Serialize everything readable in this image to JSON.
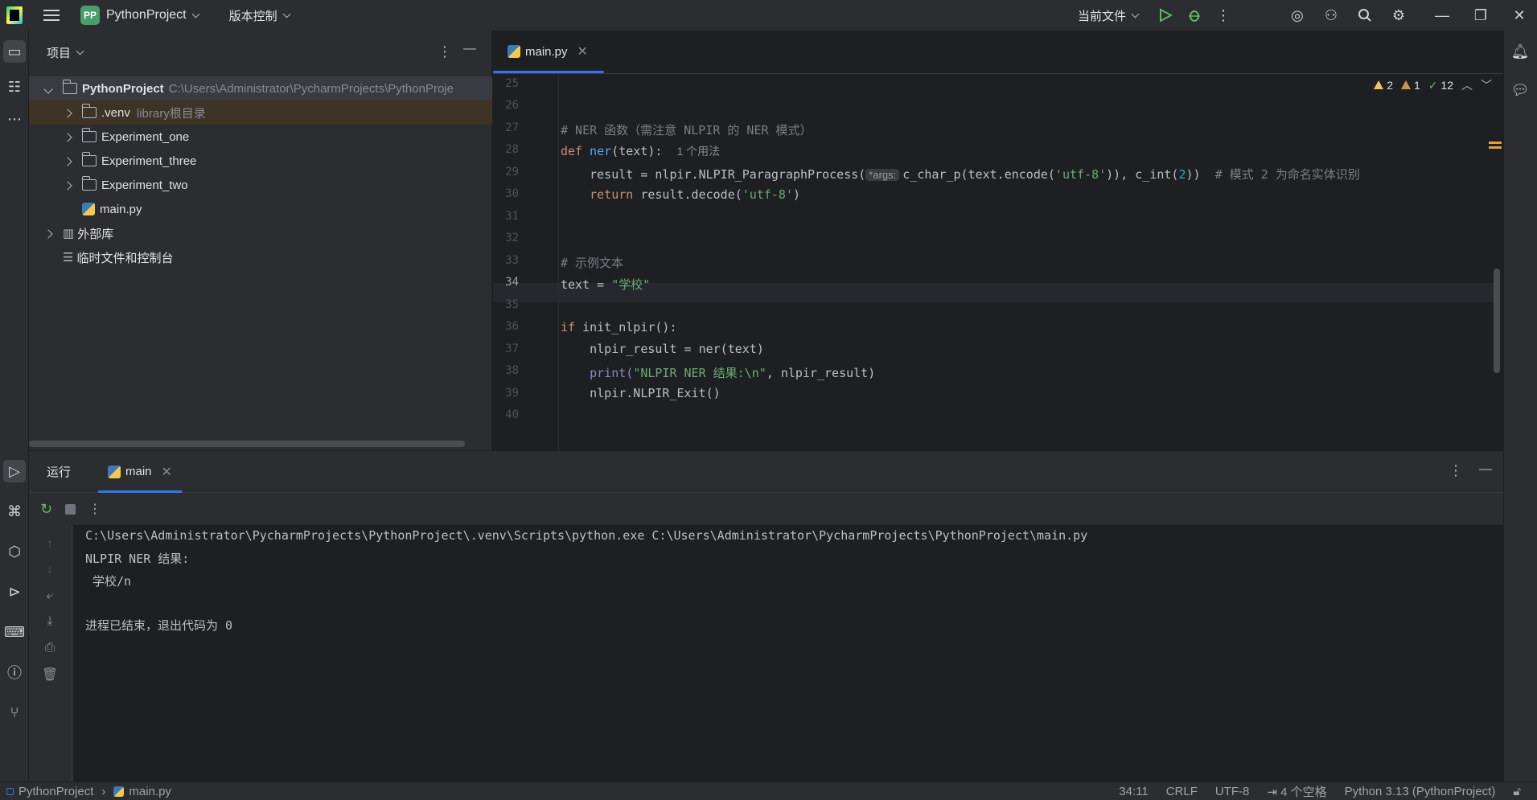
{
  "titlebar": {
    "project_badge": "PP",
    "project_name": "PythonProject",
    "vcs_menu": "版本控制",
    "run_config": "当前文件"
  },
  "project_panel": {
    "title": "项目",
    "tree": [
      {
        "label": "PythonProject",
        "extra": "C:\\Users\\Administrator\\PycharmProjects\\PythonProje"
      },
      {
        "label": ".venv",
        "extra": "library根目录"
      },
      {
        "label": "Experiment_one",
        "extra": ""
      },
      {
        "label": "Experiment_three",
        "extra": ""
      },
      {
        "label": "Experiment_two",
        "extra": ""
      },
      {
        "label": "main.py",
        "extra": ""
      },
      {
        "label": "外部库",
        "extra": ""
      },
      {
        "label": "临时文件和控制台",
        "extra": ""
      }
    ]
  },
  "editor": {
    "tab": "main.py",
    "inspections": {
      "warnings": "2",
      "weak_warnings": "1",
      "ok": "12"
    },
    "line_numbers": [
      "25",
      "26",
      "27",
      "28",
      "29",
      "30",
      "31",
      "32",
      "33",
      "34",
      "35",
      "36",
      "37",
      "38",
      "39",
      "40"
    ],
    "current_line": "34",
    "usage_hint": "1 个用法",
    "param_hint": "*args:",
    "lines": {
      "l27": "# NER 函数（需注意 NLPIR 的 NER 模式）",
      "l28_kw": "def ",
      "l28_fn": "ner",
      "l28_rest": "(text):",
      "l29_a": "    result = nlpir.NLPIR_ParagraphProcess(",
      "l29_b": "c_char_p(text.encode(",
      "l29_str": "'utf-8'",
      "l29_c": ")), c_int(",
      "l29_num": "2",
      "l29_d": "))  ",
      "l29_cmt": "# 模式 2 为命名实体识别",
      "l30_kw": "    return ",
      "l30_a": "result.decode(",
      "l30_str": "'utf-8'",
      "l30_b": ")",
      "l33": "# 示例文本",
      "l34_a": "text = ",
      "l34_str": "\"学校\"",
      "l36_kw": "if ",
      "l36_a": "init_nlpir():",
      "l37": "    nlpir_result = ner(text)",
      "l38_fn": "    print(",
      "l38_str": "\"NLPIR NER 结果:\\n\"",
      "l38_b": ", nlpir_result)",
      "l39": "    nlpir.NLPIR_Exit()"
    }
  },
  "run_panel": {
    "title": "运行",
    "tab": "main",
    "console": [
      "C:\\Users\\Administrator\\PycharmProjects\\PythonProject\\.venv\\Scripts\\python.exe C:\\Users\\Administrator\\PycharmProjects\\PythonProject\\main.py",
      "NLPIR NER 结果:",
      " 学校/n",
      "",
      "进程已结束，退出代码为 0"
    ]
  },
  "statusbar": {
    "breadcrumb_project": "PythonProject",
    "breadcrumb_file": "main.py",
    "position": "34:11",
    "line_ending": "CRLF",
    "encoding": "UTF-8",
    "indent": "4 个空格",
    "interpreter": "Python 3.13 (PythonProject)"
  },
  "colors": {
    "accent": "#3574f0",
    "keyword": "#cf8e6d",
    "string": "#6aab73",
    "function": "#56a8f5",
    "comment": "#7a7e85"
  }
}
